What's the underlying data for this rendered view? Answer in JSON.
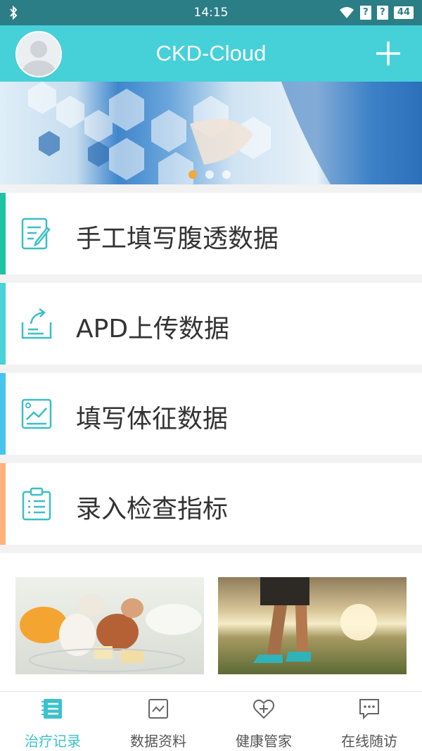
{
  "status_bar": {
    "time": "14:15",
    "battery": "44",
    "sim1": "?",
    "sim2": "?",
    "icons": [
      "bluetooth-icon",
      "wifi-icon",
      "sim-icon",
      "battery-icon"
    ]
  },
  "app_bar": {
    "title": "CKD-Cloud",
    "avatar": "avatar-icon",
    "add_icon": "plus-icon"
  },
  "banner": {
    "dots": 3,
    "active_dot": 0
  },
  "menu": {
    "items": [
      {
        "label": "手工填写腹透数据",
        "icon": "edit-document-icon",
        "accent": "#1ec3a3"
      },
      {
        "label": "APD上传数据",
        "icon": "upload-icon",
        "accent": "#49d2d9"
      },
      {
        "label": "填写体征数据",
        "icon": "chart-icon",
        "accent": "#47c4ee"
      },
      {
        "label": "录入检查指标",
        "icon": "clipboard-icon",
        "accent": "#ffb37a"
      }
    ]
  },
  "bottom_nav": {
    "items": [
      {
        "label": "治疗记录",
        "icon": "list-icon",
        "active": true
      },
      {
        "label": "数据资料",
        "icon": "chart-box-icon",
        "active": false
      },
      {
        "label": "健康管家",
        "icon": "heart-plus-icon",
        "active": false
      },
      {
        "label": "在线随访",
        "icon": "chat-icon",
        "active": false
      }
    ]
  },
  "colors": {
    "status_bar": "#2b7d86",
    "app_bar": "#46d0d8",
    "active_tab": "#3bc2cc",
    "icon_stroke": "#3bbec8",
    "text": "#333333"
  }
}
